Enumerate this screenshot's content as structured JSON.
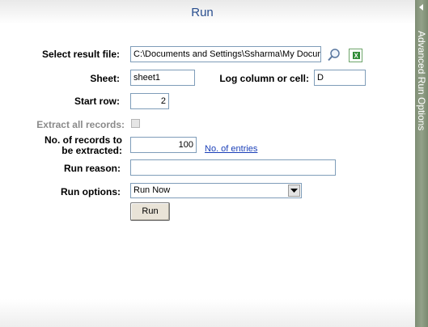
{
  "title": "Run",
  "form": {
    "result_file_label": "Select result file:",
    "result_file_value": "C:\\Documents and Settings\\Ssharma\\My Documents",
    "sheet_label": "Sheet:",
    "sheet_value": "sheet1",
    "log_column_label": "Log column or cell:",
    "log_column_value": "D",
    "start_row_label": "Start row:",
    "start_row_value": "2",
    "extract_all_label": "Extract all records:",
    "records_label_line1": "No. of records to",
    "records_label_line2": "be extracted:",
    "records_value": "100",
    "no_of_entries_link": "No. of entries",
    "run_reason_label": "Run reason:",
    "run_reason_value": "",
    "run_options_label": "Run options:",
    "run_options_selected": "Run Now",
    "run_button": "Run"
  },
  "sidebar": {
    "label": "Advanced Run Options"
  },
  "icons": {
    "browse": "magnifier-icon",
    "excel": "excel-icon"
  },
  "colors": {
    "title": "#2a4f8f",
    "link": "#1a3fb8",
    "sidebar": "#8a9980"
  }
}
